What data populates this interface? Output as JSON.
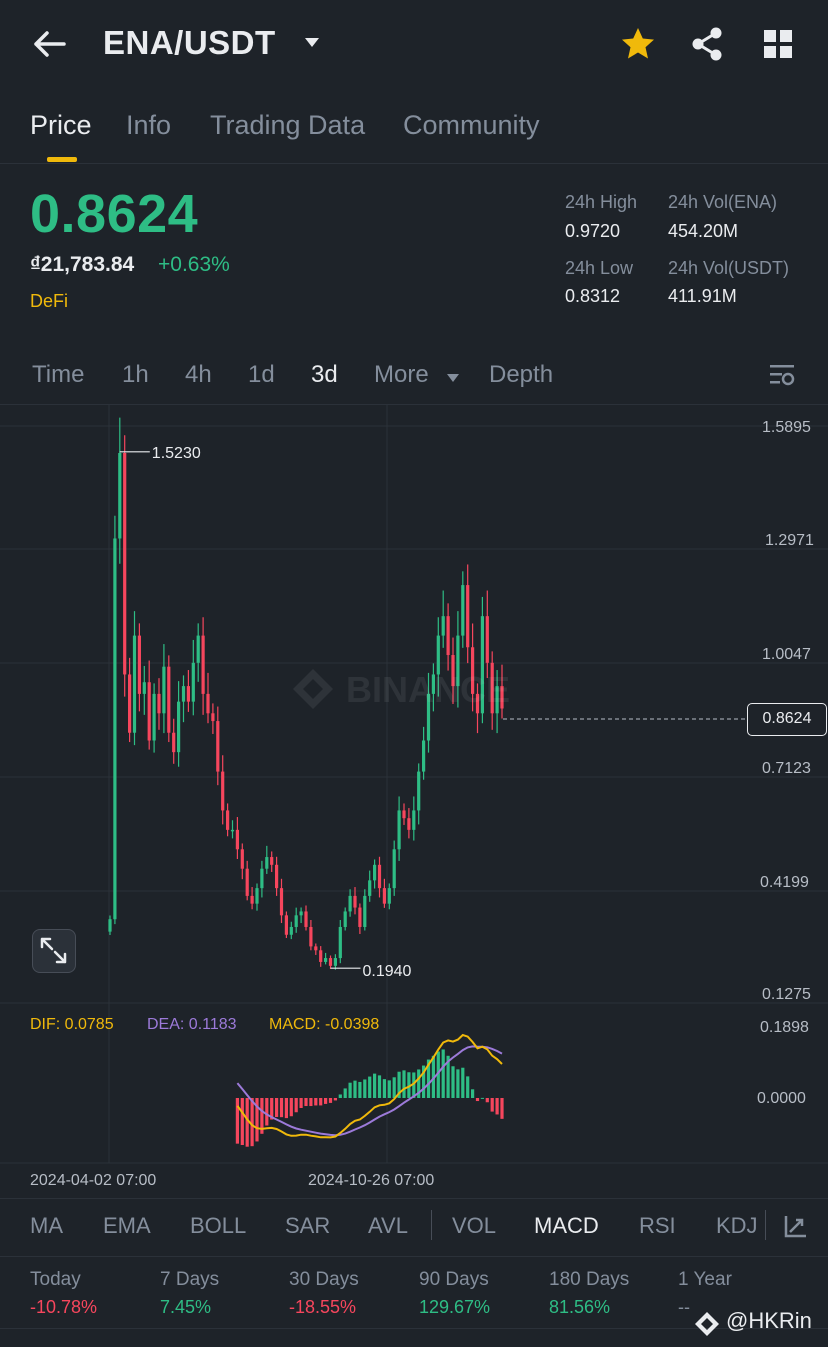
{
  "header": {
    "pair": "ENA/USDT",
    "icons": [
      "back-arrow-icon",
      "caret-down-icon",
      "star-icon",
      "share-icon",
      "grid-icon"
    ],
    "star_color": "#f0b90b"
  },
  "tabs": [
    {
      "label": "Price",
      "active": true
    },
    {
      "label": "Info",
      "active": false
    },
    {
      "label": "Trading Data",
      "active": false
    },
    {
      "label": "Community",
      "active": false
    }
  ],
  "ticker": {
    "last_price": "0.8624",
    "fiat_value": "₫21,783.84",
    "change_pct": "+0.63%",
    "category": "DeFi",
    "stats": {
      "high_label": "24h High",
      "high_value": "0.9720",
      "vol_base_label": "24h Vol(ENA)",
      "vol_base_value": "454.20M",
      "low_label": "24h Low",
      "low_value": "0.8312",
      "vol_quote_label": "24h Vol(USDT)",
      "vol_quote_value": "411.91M"
    }
  },
  "intervals": [
    {
      "label": "Time",
      "active": false
    },
    {
      "label": "1h",
      "active": false
    },
    {
      "label": "4h",
      "active": false
    },
    {
      "label": "1d",
      "active": false
    },
    {
      "label": "3d",
      "active": true
    },
    {
      "label": "More",
      "active": false
    },
    {
      "label": "Depth",
      "active": false
    }
  ],
  "chart_data": {
    "type": "candlestick",
    "y_axis_ticks": [
      "1.5895",
      "1.2971",
      "1.0047",
      "0.7123",
      "0.4199",
      "0.1275"
    ],
    "ylim": [
      0.1275,
      1.5895
    ],
    "x_axis_ticks": [
      "2024-04-02 07:00",
      "2024-10-26 07:00"
    ],
    "current_price": "0.8624",
    "max_marker": "1.5230",
    "min_marker": "0.1940",
    "watermark": "BINANCE",
    "closes": [
      0.32,
      1.3,
      1.52,
      0.95,
      0.8,
      1.05,
      0.9,
      0.93,
      0.78,
      0.9,
      0.85,
      0.97,
      0.8,
      0.75,
      0.88,
      0.92,
      0.88,
      0.98,
      1.05,
      0.9,
      0.85,
      0.83,
      0.7,
      0.6,
      0.55,
      0.55,
      0.5,
      0.45,
      0.38,
      0.36,
      0.4,
      0.45,
      0.48,
      0.46,
      0.4,
      0.33,
      0.28,
      0.3,
      0.33,
      0.34,
      0.3,
      0.25,
      0.24,
      0.21,
      0.22,
      0.2,
      0.22,
      0.3,
      0.34,
      0.38,
      0.35,
      0.3,
      0.38,
      0.42,
      0.46,
      0.4,
      0.36,
      0.4,
      0.5,
      0.6,
      0.58,
      0.55,
      0.6,
      0.7,
      0.78,
      0.9,
      0.95,
      1.05,
      1.1,
      1.0,
      0.92,
      1.05,
      1.18,
      1.02,
      0.9,
      0.85,
      1.1,
      0.98,
      0.85,
      0.92,
      0.8624
    ],
    "macd": {
      "dif_label": "DIF: 0.0785",
      "dea_label": "DEA: 0.1183",
      "macd_label": "MACD: -0.0398",
      "y_axis_ticks": [
        "0.1898",
        "0.0000"
      ],
      "dif_color": "#f0b90b",
      "dea_color": "#9c7ad9"
    }
  },
  "indicators": {
    "main": [
      "MA",
      "EMA",
      "BOLL",
      "SAR",
      "AVL"
    ],
    "sub": [
      "VOL",
      "MACD",
      "RSI",
      "KDJ"
    ],
    "active": "MACD"
  },
  "performance": [
    {
      "label": "Today",
      "value": "-10.78%",
      "trend": "down"
    },
    {
      "label": "7 Days",
      "value": "7.45%",
      "trend": "up"
    },
    {
      "label": "30 Days",
      "value": "-18.55%",
      "trend": "down"
    },
    {
      "label": "90 Days",
      "value": "129.67%",
      "trend": "up"
    },
    {
      "label": "180 Days",
      "value": "81.56%",
      "trend": "up"
    },
    {
      "label": "1 Year",
      "value": "--",
      "trend": "none"
    }
  ],
  "credit": "@HKRin",
  "colors": {
    "up": "#2ebd85",
    "down": "#f6465d",
    "accent": "#f0b90b",
    "background": "#1e2329"
  }
}
